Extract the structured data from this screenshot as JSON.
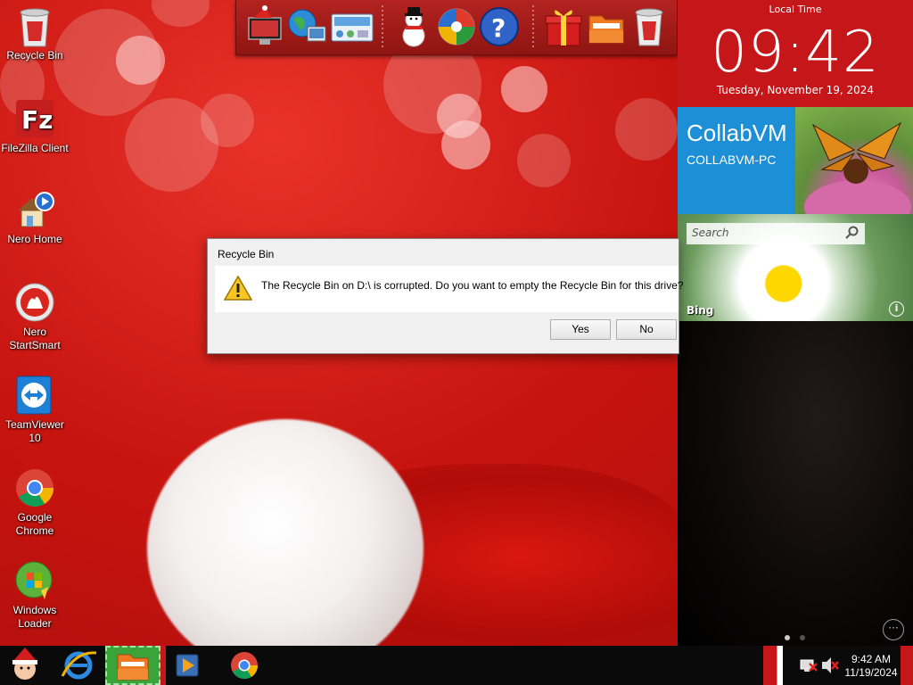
{
  "desktop_icons": [
    {
      "label": "Recycle Bin",
      "icon": "recycle-bin-full-icon"
    },
    {
      "label": "FileZilla Client",
      "icon": "filezilla-icon"
    },
    {
      "label": "Nero Home",
      "icon": "nero-home-icon"
    },
    {
      "label": "Nero StartSmart",
      "icon": "nero-startsmart-icon"
    },
    {
      "label": "TeamViewer 10",
      "icon": "teamviewer-icon"
    },
    {
      "label": "Google Chrome",
      "icon": "chrome-icon"
    },
    {
      "label": "Windows Loader",
      "icon": "windows-loader-icon"
    }
  ],
  "dock": {
    "items": [
      "santa-computer-icon",
      "globe-network-icon",
      "control-panel-icon",
      "snowman-icon",
      "windows-media-icon",
      "help-icon",
      "gift-icon",
      "folder-icon",
      "recycle-bin-icon"
    ]
  },
  "clock": {
    "label": "Local Time",
    "time": "09:42",
    "date": "Tuesday, November 19, 2024"
  },
  "tiles": {
    "collab_title": "CollabVM",
    "collab_subtitle": "COLLABVM-PC",
    "bing_label": "Bing",
    "search_placeholder": "Search",
    "info_glyph": "i",
    "more_glyph": "···"
  },
  "dialog": {
    "title": "Recycle Bin",
    "message": "The Recycle Bin on D:\\ is corrupted. Do you want to empty the Recycle Bin for this drive?",
    "yes_label": "Yes",
    "no_label": "No"
  },
  "taskbar": {
    "time": "9:42 AM",
    "date": "11/19/2024",
    "items": [
      "santa-start-icon",
      "internet-explorer-icon",
      "file-explorer-icon",
      "media-player-icon",
      "chrome-icon"
    ]
  },
  "colors": {
    "desktop_red": "#c8140f",
    "clock_red": "#c5161a",
    "tile_blue": "#1c8fd6",
    "taskbar": "#0a0a0a"
  }
}
